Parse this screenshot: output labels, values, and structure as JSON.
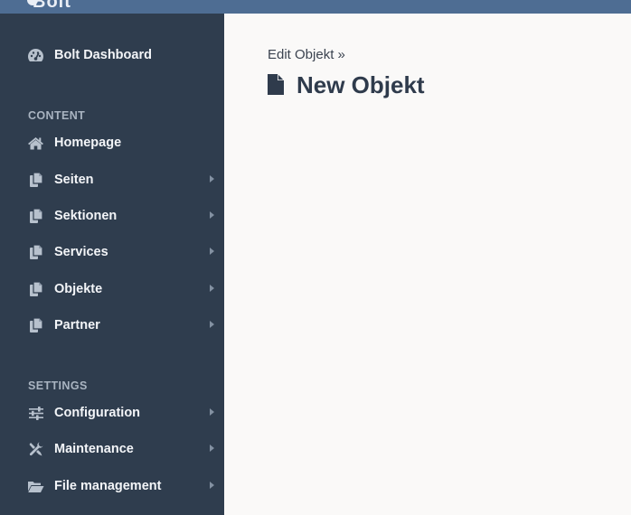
{
  "topbar": {
    "brand": "Bolt"
  },
  "sidebar": {
    "dashboard_label": "Bolt Dashboard",
    "content_title": "CONTENT",
    "content_items": [
      {
        "label": "Homepage",
        "icon": "home-icon",
        "has_submenu": false
      },
      {
        "label": "Seiten",
        "icon": "copy-icon",
        "has_submenu": true
      },
      {
        "label": "Sektionen",
        "icon": "copy-icon",
        "has_submenu": true
      },
      {
        "label": "Services",
        "icon": "copy-icon",
        "has_submenu": true
      },
      {
        "label": "Objekte",
        "icon": "copy-icon",
        "has_submenu": true
      },
      {
        "label": "Partner",
        "icon": "copy-icon",
        "has_submenu": true
      }
    ],
    "settings_title": "SETTINGS",
    "settings_items": [
      {
        "label": "Configuration",
        "icon": "sliders-icon",
        "has_submenu": true
      },
      {
        "label": "Maintenance",
        "icon": "tools-icon",
        "has_submenu": true
      },
      {
        "label": "File management",
        "icon": "folder-open-icon",
        "has_submenu": true
      }
    ]
  },
  "main": {
    "breadcrumb": "Edit Objekt »",
    "title": "New Objekt",
    "title_icon": "file-icon"
  },
  "colors": {
    "topbar": "#4e6d93",
    "sidebar": "#2f3d4e",
    "main_background": "#faf9f8",
    "title_text": "#2f3b4c"
  }
}
